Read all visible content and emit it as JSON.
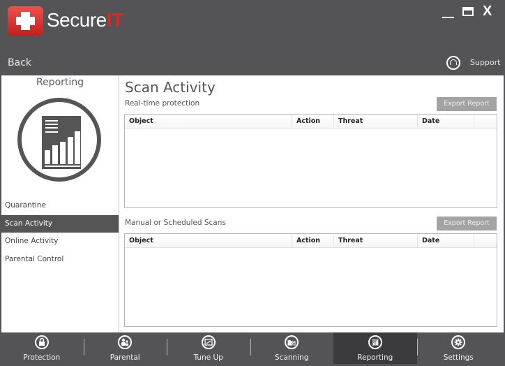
{
  "app": {
    "name_prefix": "Secure",
    "name_suffix": "IT",
    "brand_color": "#e8231f",
    "window_controls": {
      "minimize": "minimize-icon",
      "maximize": "maximize-icon",
      "close": "X"
    }
  },
  "header": {
    "back_label": "Back",
    "support_label": "Support",
    "support_icon": "headset-icon"
  },
  "sidebar": {
    "title": "Reporting",
    "icon": "report-chart-icon",
    "items": [
      {
        "label": "Quarantine",
        "active": false
      },
      {
        "label": "Scan Activity",
        "active": true
      },
      {
        "label": "Online Activity",
        "active": false
      },
      {
        "label": "Parental Control",
        "active": false
      }
    ]
  },
  "main": {
    "title": "Scan Activity",
    "sections": [
      {
        "label": "Real-time protection",
        "export_label": "Export Report",
        "columns": [
          "Object",
          "Action",
          "Threat",
          "Date"
        ],
        "rows": []
      },
      {
        "label": "Manual or Scheduled Scans",
        "export_label": "Export Report",
        "columns": [
          "Object",
          "Action",
          "Threat",
          "Date"
        ],
        "rows": []
      }
    ]
  },
  "bottom_nav": {
    "tabs": [
      {
        "label": "Protection",
        "icon": "lock-icon",
        "active": false
      },
      {
        "label": "Parental",
        "icon": "users-icon",
        "active": false
      },
      {
        "label": "Tune Up",
        "icon": "monitor-icon",
        "active": false
      },
      {
        "label": "Scanning",
        "icon": "folder-search-icon",
        "active": false
      },
      {
        "label": "Reporting",
        "icon": "report-icon",
        "active": true
      },
      {
        "label": "Settings",
        "icon": "gear-icon",
        "active": false
      }
    ]
  }
}
